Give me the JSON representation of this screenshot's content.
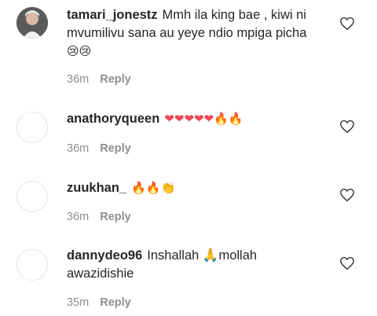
{
  "comments": [
    {
      "username": "tamari_jonestz",
      "text": "Mmh ila king bae , kiwi ni mvumilivu sana au yeye ndio mpiga picha",
      "emoji": "😢😢",
      "time": "36m",
      "reply_label": "Reply",
      "avatar_icon": "user-photo"
    },
    {
      "username": "anathoryqueen",
      "text": "",
      "emoji": "❤❤❤❤❤🔥🔥",
      "time": "36m",
      "reply_label": "Reply",
      "avatar_icon": "default-avatar"
    },
    {
      "username": "zuukhan_",
      "text": "",
      "emoji": "🔥🔥👏",
      "time": "36m",
      "reply_label": "Reply",
      "avatar_icon": "default-avatar"
    },
    {
      "username": "dannydeo96",
      "text": "Inshallah 🙏mollah awazidishie",
      "emoji": "",
      "time": "35m",
      "reply_label": "Reply",
      "avatar_icon": "default-avatar"
    }
  ],
  "colors": {
    "text": "#262626",
    "meta": "#8e8e8e",
    "heart_red": "#ed4956",
    "fire": "#ff7a00"
  },
  "icons": {
    "like": "heart-outline-icon"
  }
}
